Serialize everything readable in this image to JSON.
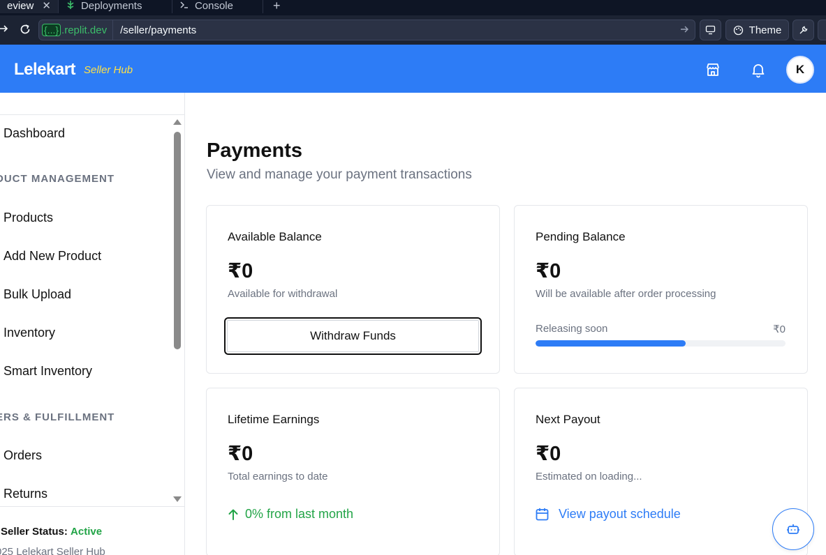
{
  "browser": {
    "tabs": [
      {
        "label": "eview",
        "close": "✕"
      },
      {
        "label": "Deployments"
      },
      {
        "label": "Console"
      }
    ],
    "new_tab": "+",
    "domain_brace": "{...}",
    "domain": ".replit.dev",
    "path": "/seller/payments",
    "theme_label": "Theme"
  },
  "header": {
    "logo": "Lelekart",
    "logo_sub": "Seller Hub",
    "avatar_initial": "K",
    "accent": "#2d7cf6"
  },
  "sidebar": {
    "items": [
      {
        "label": "Dashboard"
      },
      {
        "section": "DUCT MANAGEMENT"
      },
      {
        "label": "Products"
      },
      {
        "label": "Add New Product"
      },
      {
        "label": "Bulk Upload"
      },
      {
        "label": "Inventory"
      },
      {
        "label": "Smart Inventory"
      },
      {
        "section": "ERS & FULFILLMENT"
      },
      {
        "label": "Orders"
      },
      {
        "label": "Returns"
      }
    ],
    "status_label": "Seller Status:",
    "status_value": "Active",
    "copyright": "025 Lelekart Seller Hub"
  },
  "main": {
    "title": "Payments",
    "subtitle": "View and manage your payment transactions",
    "cards": {
      "available": {
        "title": "Available Balance",
        "amount": "₹0",
        "desc": "Available for withdrawal",
        "button": "Withdraw Funds"
      },
      "pending": {
        "title": "Pending Balance",
        "amount": "₹0",
        "desc": "Will be available after order processing",
        "release_label": "Releasing soon",
        "release_value": "₹0",
        "release_progress": 0.6
      },
      "lifetime": {
        "title": "Lifetime Earnings",
        "amount": "₹0",
        "desc": "Total earnings to date",
        "trend": "0% from last month"
      },
      "next_payout": {
        "title": "Next Payout",
        "amount": "₹0",
        "desc": "Estimated on loading...",
        "link": "View payout schedule"
      }
    }
  }
}
